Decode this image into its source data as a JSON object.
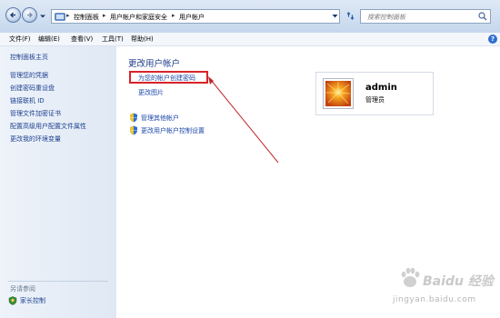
{
  "address_bar": {
    "breadcrumbs": [
      "控制面板",
      "用户帐户和家庭安全",
      "用户帐户"
    ],
    "search_placeholder": "搜索控制面板"
  },
  "menu": {
    "items": [
      "文件(F)",
      "编辑(E)",
      "查看(V)",
      "工具(T)",
      "帮助(H)"
    ]
  },
  "left_pane": {
    "home": "控制面板主页",
    "links": [
      "管理您的凭据",
      "创建密码重设盘",
      "链接联机 ID",
      "管理文件加密证书",
      "配置高级用户配置文件属性",
      "更改我的环境变量"
    ],
    "see_also": "另请参阅",
    "family_safety": "家长控制"
  },
  "main": {
    "title": "更改用户帐户",
    "tasks": [
      "为您的帐户创建密码",
      "更改图片"
    ],
    "shield_tasks": [
      "管理其他帐户",
      "更改用户帐户控制设置"
    ]
  },
  "account": {
    "name": "admin",
    "role": "管理员"
  },
  "help_icon": "?",
  "watermark": {
    "text1": "Baidu 经验",
    "text2": "jingyan.baidu.com"
  },
  "colors": {
    "link": "#1c47a8",
    "highlight": "#d9232a",
    "arrow": "#c0282c"
  }
}
